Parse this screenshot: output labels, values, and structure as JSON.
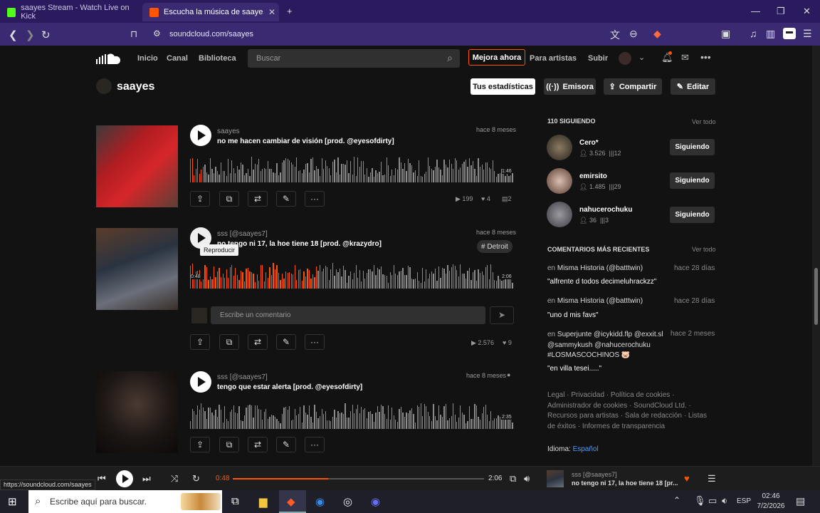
{
  "browser": {
    "tabs": [
      {
        "title": "saayes Stream - Watch Live on Kick",
        "favicon_color": "#53fc18"
      },
      {
        "title": "Escucha la música de saayes | Di",
        "favicon_color": "#ff5500"
      }
    ],
    "url": "soundcloud.com/saayes",
    "status_url": "https://soundcloud.com/saayes"
  },
  "header": {
    "nav": [
      "Inicio",
      "Canal",
      "Biblioteca"
    ],
    "search_placeholder": "Buscar",
    "upgrade_label": "Mejora ahora",
    "artists_label": "Para artistas",
    "upload_label": "Subir"
  },
  "profile": {
    "name": "saayes",
    "stats_button": "Tus estadísticas",
    "station_button": "Emisora",
    "share_button": "Compartir",
    "edit_button": "Editar"
  },
  "tracks": [
    {
      "artist": "saayes",
      "title": "no me hacen cambiar de visión [prod. @eyesofdirty]",
      "ago": "hace 8 meses",
      "duration": "1:46",
      "progress": 0.04,
      "plays": "199",
      "likes": "4",
      "comments": "2"
    },
    {
      "artist": "sss [@saayes7]",
      "title": "no tengo ni 17, la hoe tiene 18 [prod. @krazydro]",
      "ago": "hace 8 meses",
      "tag": "# Detroit",
      "tooltip": "Reproducir",
      "elapsed": "0:48",
      "duration": "2:06",
      "progress": 0.39,
      "comment_placeholder": "Escribe un comentario",
      "plays": "2.576",
      "likes": "9"
    },
    {
      "artist": "sss [@saayes7]",
      "title": "tengo que estar alerta [prod. @eyesofdirty]",
      "ago": "hace 8 meses",
      "duration": "2:35",
      "progress": 0
    }
  ],
  "sidebar": {
    "following_header": "110 SIGUIENDO",
    "see_all": "Ver todo",
    "following": [
      {
        "name": "Cero*",
        "followers": "3.526",
        "tracks": "12",
        "button": "Siguiendo"
      },
      {
        "name": "emirsito",
        "followers": "1.485",
        "tracks": "29",
        "button": "Siguiendo"
      },
      {
        "name": "nahucerochuku",
        "followers": "36",
        "tracks": "3",
        "button": "Siguiendo"
      }
    ],
    "comments_header": "COMENTARIOS MÁS RECIENTES",
    "comments": [
      {
        "prefix": "en",
        "track": "Misma Historia (@batttwin)",
        "ago": "hace 28 días",
        "text": "\"alfrente d todos decimeluhrackzz\""
      },
      {
        "prefix": "en",
        "track": "Misma Historia (@batttwin)",
        "ago": "hace 28 días",
        "text": "\"uno d mis favs\""
      },
      {
        "prefix": "en",
        "track": "Superjunte @icykidd.flp @exxit.sl @sammykush @nahucerochuku #LOSMASCOCHINOS 🐷",
        "ago": "hace 2 meses",
        "text": "\"en villa tesei.....\""
      }
    ],
    "footer_links": "Legal · Privacidad · Política de cookies · Administrador de cookies · SoundCloud Ltd. · Recursos para artistas · Sala de redacción · Listas de éxitos · Informes de transparencia",
    "language_label": "Idioma:",
    "language_value": "Español"
  },
  "player": {
    "elapsed": "0:48",
    "duration": "2:06",
    "progress": 0.38,
    "artist": "sss [@saayes7]",
    "title": "no tengo ni 17, la hoe tiene 18 [pr..."
  },
  "taskbar": {
    "search_placeholder": "Escribe aquí para buscar.",
    "lang": "ESP",
    "time": "02:46",
    "date": "7/2/2026"
  },
  "colors": {
    "accent": "#ff5500",
    "wave_idle": "#8c8c8c",
    "wave_played": "#ff5500"
  }
}
